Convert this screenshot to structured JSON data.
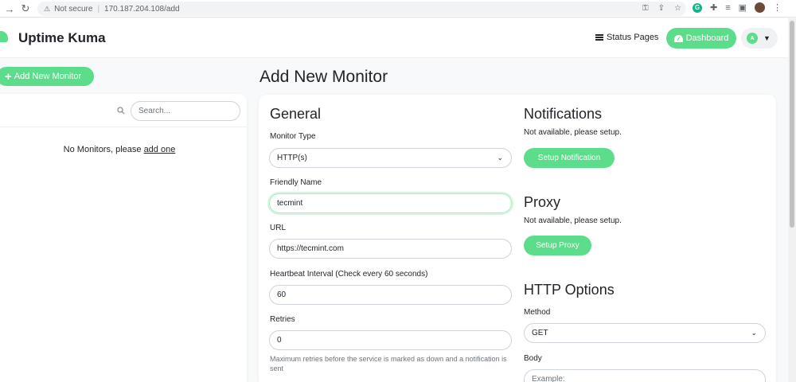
{
  "browser": {
    "security": "Not secure",
    "url": "170.187.204.108/add"
  },
  "header": {
    "brand": "Uptime Kuma",
    "status_pages": "Status Pages",
    "dashboard": "Dashboard",
    "avatar_letter": "A"
  },
  "sidebar": {
    "add_button": "Add New Monitor",
    "search_placeholder": "Search...",
    "empty_text": "No Monitors, please",
    "empty_link": "add one"
  },
  "page": {
    "title": "Add New Monitor"
  },
  "general": {
    "heading": "General",
    "monitor_type_label": "Monitor Type",
    "monitor_type_value": "HTTP(s)",
    "friendly_name_label": "Friendly Name",
    "friendly_name_value": "tecmint",
    "url_label": "URL",
    "url_value": "https://tecmint.com",
    "interval_label": "Heartbeat Interval (Check every 60 seconds)",
    "interval_value": "60",
    "retries_label": "Retries",
    "retries_value": "0",
    "retries_hint": "Maximum retries before the service is marked as down and a notification is sent"
  },
  "notifications": {
    "heading": "Notifications",
    "text": "Not available, please setup.",
    "button": "Setup Notification"
  },
  "proxy": {
    "heading": "Proxy",
    "text": "Not available, please setup.",
    "button": "Setup Proxy"
  },
  "http_options": {
    "heading": "HTTP Options",
    "method_label": "Method",
    "method_value": "GET",
    "body_label": "Body",
    "body_placeholder": "Example:"
  },
  "colors": {
    "accent": "#5cdd8b"
  }
}
